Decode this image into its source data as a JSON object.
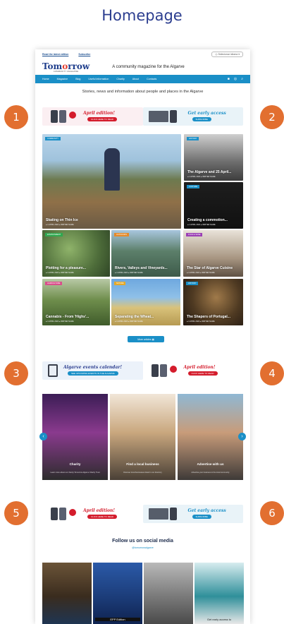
{
  "heading": "Homepage",
  "topbar": {
    "link1": "Read the latest edition",
    "link2": "Subscribe",
    "language": "Selecionar idioma"
  },
  "masthead": {
    "logo_pre": "Tom",
    "logo_o": "o",
    "logo_post": "rrow",
    "logo_sub": "COMMUNITY MAGAZINE",
    "tagline": "A community magazine for the Algarve"
  },
  "nav": {
    "items": [
      "Home",
      "Magazine",
      "Blog",
      "Useful information",
      "Charity",
      "About",
      "Contacts"
    ]
  },
  "subtitle": "Stories, news and information about people and places in the Algarve",
  "banners": {
    "edition_title": "April edition!",
    "edition_btn": "CLICK HERE TO READ",
    "access_title": "Get early access",
    "access_btn": "SUBSCRIBE",
    "events_title": "Algarve events calendar!",
    "events_btn": "SEE UPCOMING EVENTS IN THE ALGARVE"
  },
  "articles": [
    {
      "tag": "COMMUNITY",
      "title": "Skating on Thin Ice",
      "meta": "● 1 APRIL 2024  ● WRITER NAME"
    },
    {
      "tag": "HISTORY",
      "title": "The Algarve and 25 April...",
      "meta": "● 1 APRIL 2024  ● WRITER NAME"
    },
    {
      "tag": "CULTURE",
      "title": "Creating a commotion...",
      "meta": "● 1 APRIL 2024  ● WRITER NAME"
    },
    {
      "tag": "ENVIRONMENT",
      "title": "Plotting for a pleasure...",
      "meta": "● 1 APRIL 2024  ● WRITER NAME"
    },
    {
      "tag": "OUTDOORS",
      "title": "Rivers, Valleys and Vineyards...",
      "meta": "● 1 APRIL 2024  ● WRITER NAME"
    },
    {
      "tag": "FOOD & WINE",
      "title": "The Star of Algarve Cuisine",
      "meta": "● 1 APRIL 2024  ● WRITER NAME"
    },
    {
      "tag": "AGRICULTURE",
      "title": "Cannabis - From 'Highs'...",
      "meta": "● 1 APRIL 2024  ● WRITER NAME"
    },
    {
      "tag": "NATURE",
      "title": "Separating the Wheat...",
      "meta": "● 1 APRIL 2024  ● WRITER NAME"
    },
    {
      "tag": "HISTORY",
      "title": "The Shapers of Portugal...",
      "meta": "● 1 APRIL 2024  ● WRITER NAME"
    }
  ],
  "more_button": "More articles",
  "carousel": [
    {
      "title": "Charity",
      "desc": "Learn more about our charity Tomorrow Algarve Charity Trust"
    },
    {
      "title": "Find a local business",
      "desc": "Discover local businesses listed in our directory"
    },
    {
      "title": "Advertise with us",
      "desc": "Advertise your business to the local community"
    }
  ],
  "follow": "Follow us on social media",
  "handle": "@tomorrowalgarve",
  "social": [
    {
      "text": ""
    },
    {
      "text": "EPP Edition"
    },
    {
      "text": ""
    },
    {
      "text": "Get early access to"
    }
  ],
  "markers": [
    "1",
    "2",
    "3",
    "4",
    "5",
    "6"
  ],
  "colors": {
    "brand_blue": "#1a8fc7",
    "heading_blue": "#2b3d8f",
    "marker_orange": "#e26f30",
    "logo_red": "#e23b2d"
  }
}
